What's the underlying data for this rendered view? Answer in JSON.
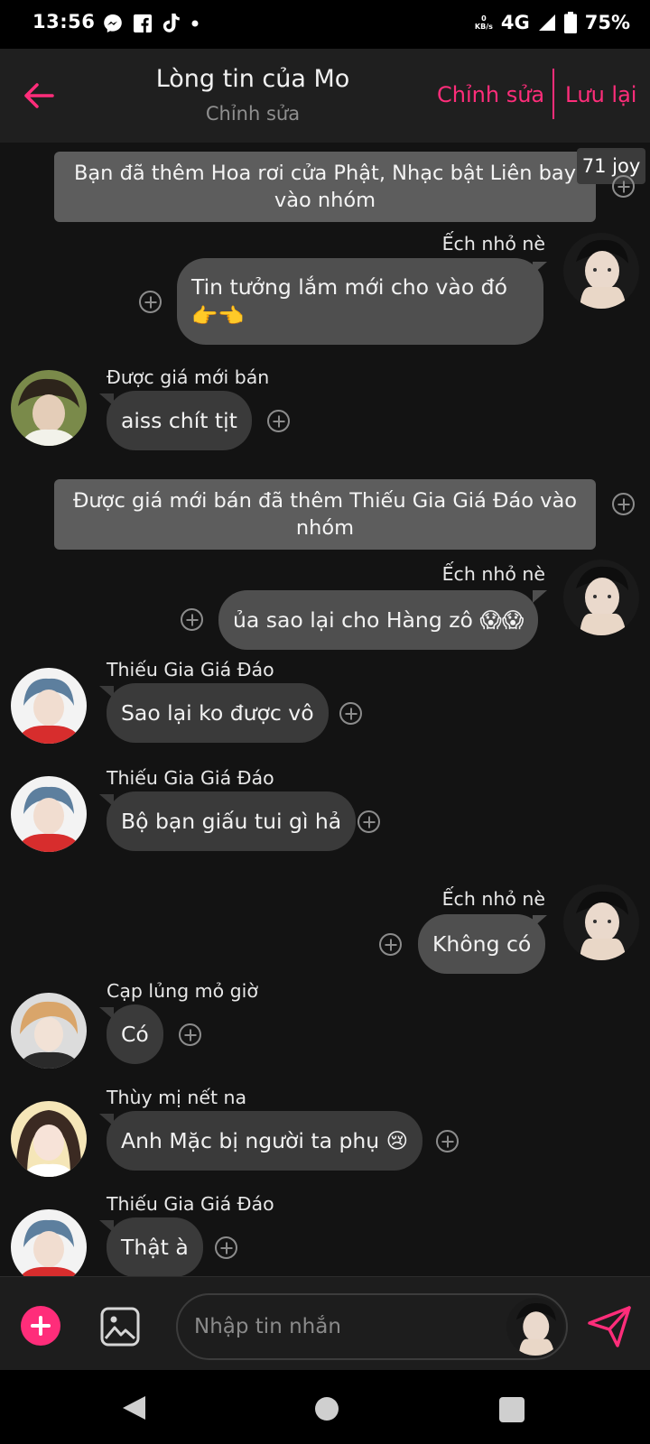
{
  "status_bar": {
    "time": "13:56",
    "net_speed_value": "0",
    "net_speed_unit": "KB/s",
    "network": "4G",
    "battery": "75%",
    "left_icons": [
      "messenger-icon",
      "facebook-icon",
      "tiktok-icon",
      "dot-icon"
    ]
  },
  "header": {
    "title": "Lòng tin của Mo",
    "subtitle": "Chỉnh sửa",
    "edit_label": "Chỉnh sửa",
    "save_label": "Lưu lại"
  },
  "badge": "71 joy",
  "messages": [
    {
      "type": "system",
      "text": "Bạn đã thêm Hoa rơi cửa Phật, Nhạc bật Liên bay vào nhóm"
    },
    {
      "type": "outgoing",
      "sender": "Ếch nhỏ nè",
      "text": "Tin tưởng lắm mới cho vào đó 👉👈"
    },
    {
      "type": "incoming",
      "sender": "Được giá mới bán",
      "text": "aiss chít tịt"
    },
    {
      "type": "system",
      "text": "Được giá mới bán đã thêm Thiếu Gia Giá Đáo vào nhóm"
    },
    {
      "type": "outgoing",
      "sender": "Ếch nhỏ nè",
      "text": "ủa sao lại cho Hàng zô 😱😱"
    },
    {
      "type": "incoming",
      "sender": "Thiếu Gia Giá Đáo",
      "text": "Sao lại ko được vô"
    },
    {
      "type": "incoming",
      "sender": "Thiếu Gia Giá Đáo",
      "text": "Bộ bạn giấu tui gì hả"
    },
    {
      "type": "outgoing",
      "sender": "Ếch nhỏ nè",
      "text": "Không có"
    },
    {
      "type": "incoming",
      "sender": "Cạp lủng mỏ giờ",
      "text": "Có"
    },
    {
      "type": "incoming",
      "sender": "Thùy mị nết na",
      "text": "Anh Mặc bị người ta phụ 😢"
    },
    {
      "type": "incoming",
      "sender": "Thiếu Gia Giá Đáo",
      "text": "Thật à"
    }
  ],
  "input": {
    "placeholder": "Nhập tin nhắn"
  },
  "colors": {
    "accent": "#ff2d7a",
    "background": "#131313",
    "bubble_incoming": "#3a3a3a",
    "bubble_outgoing": "#4f4f4f",
    "system_bubble": "#5d5d5d"
  }
}
